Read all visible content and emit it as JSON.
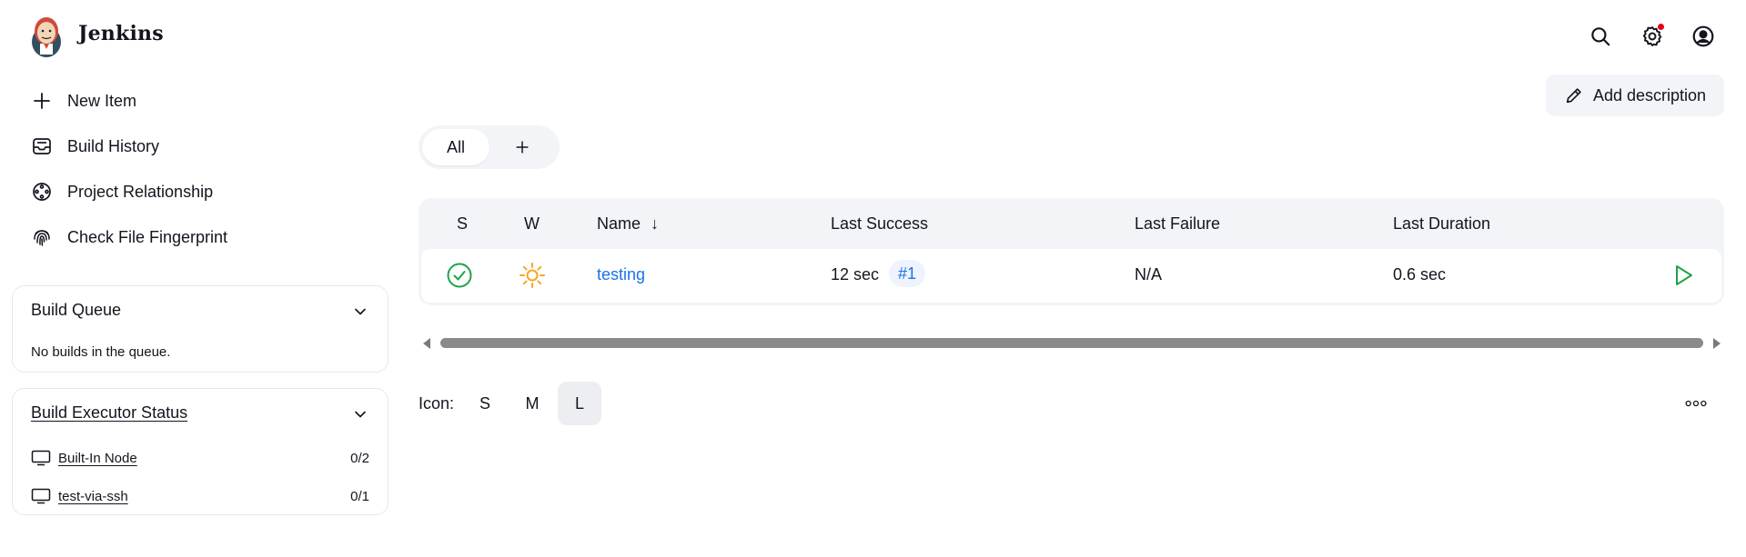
{
  "header": {
    "brand": "Jenkins",
    "icons": [
      "search-icon",
      "settings-icon",
      "user-icon"
    ],
    "notification_color": "#e6001f"
  },
  "sidebar": {
    "tasks": [
      {
        "label": "New Item",
        "icon": "plus-icon"
      },
      {
        "label": "Build History",
        "icon": "inbox-icon"
      },
      {
        "label": "Project Relationship",
        "icon": "relationship-icon"
      },
      {
        "label": "Check File Fingerprint",
        "icon": "fingerprint-icon"
      }
    ],
    "build_queue": {
      "title": "Build Queue",
      "empty_text": "No builds in the queue."
    },
    "executor_status": {
      "title": "Build Executor Status",
      "nodes": [
        {
          "name": "Built-In Node",
          "count": "0/2"
        },
        {
          "name": "test-via-ssh",
          "count": "0/1"
        }
      ]
    }
  },
  "main": {
    "add_description_label": "Add description",
    "tabs": [
      {
        "label": "All"
      }
    ],
    "add_tab_icon": "plus-icon",
    "table": {
      "headers": {
        "status": "S",
        "weather": "W",
        "name": "Name",
        "name_sort": "↓",
        "last_success": "Last Success",
        "last_failure": "Last Failure",
        "last_duration": "Last Duration"
      },
      "rows": [
        {
          "status": "success",
          "weather": "sunny",
          "name": "testing",
          "last_success": "12 sec",
          "last_success_build": "#1",
          "last_failure": "N/A",
          "last_duration": "0.6 sec"
        }
      ]
    },
    "icon_size": {
      "label": "Icon:",
      "options": [
        "S",
        "M",
        "L"
      ],
      "selected": "L"
    }
  },
  "colors": {
    "success": "#1ea446",
    "sunny": "#f5a623",
    "link": "#1a73e8",
    "panel_bg": "#f2f4f7"
  }
}
